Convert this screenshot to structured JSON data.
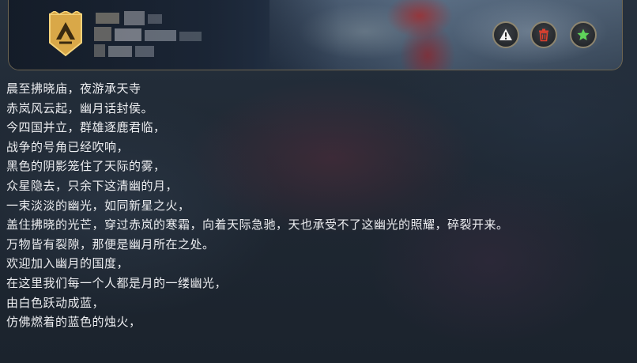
{
  "header": {
    "emblem_icon": "shield-banner-icon",
    "name_obscured": true,
    "actions": [
      {
        "name": "report-button",
        "icon": "warning-icon",
        "color": "#f2f2f2"
      },
      {
        "name": "delete-button",
        "icon": "trash-icon",
        "color": "#e0402e"
      },
      {
        "name": "favorite-button",
        "icon": "star-icon",
        "color": "#5fd35a"
      }
    ]
  },
  "message": {
    "lines": [
      "晨至拂晓庙，夜游承天寺",
      "赤岚风云起，幽月话封侯。",
      "今四国并立，群雄逐鹿君临，",
      "战争的号角已经吹响，",
      "黑色的阴影笼住了天际的雾，",
      "众星隐去，只余下这清幽的月，",
      "一束淡淡的幽光，如同新星之火，",
      "盖住拂晓的光芒，穿过赤岚的寒霜，向着天际急驰，天也承受不了这幽光的照耀，碎裂开来。",
      "万物皆有裂隙，那便是幽月所在之处。",
      "欢迎加入幽月的国度，",
      "在这里我们每一个人都是月的一缕幽光，",
      "由白色跃动成蓝，",
      "仿佛燃着的蓝色的烛火，"
    ]
  }
}
